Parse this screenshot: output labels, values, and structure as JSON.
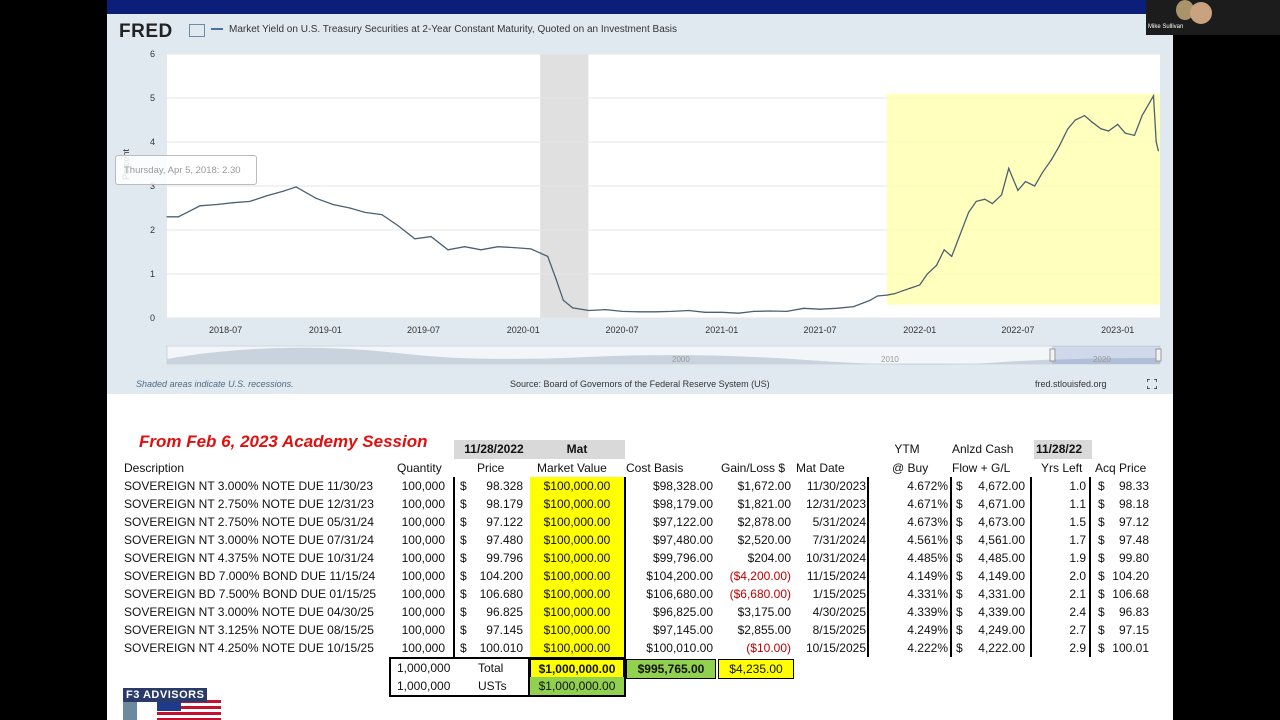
{
  "fred": {
    "logo": "FRED",
    "series_title": "Market Yield on U.S. Treasury Securities at 2-Year Constant Maturity, Quoted on an Investment Basis",
    "y_axis_label": "Percent",
    "tooltip": {
      "date": "Thursday, Apr 5, 2018:",
      "value": "2.30"
    },
    "note": "Shaded areas indicate U.S. recessions.",
    "source": "Source: Board of Governors of the Federal Reserve System (US)",
    "site": "fred.stlouisfed.org",
    "navigator_labels": [
      "2000",
      "2010",
      "2020"
    ],
    "colors": {
      "line": "#4c6072",
      "recession": "#e0e0e0",
      "highlight": "#ffffb3",
      "frame": "#e1e9f0"
    }
  },
  "chart_data": {
    "type": "line",
    "title": "Market Yield on U.S. Treasury Securities at 2-Year Constant Maturity, Quoted on an Investment Basis",
    "ylabel": "Percent",
    "ylim": [
      0,
      6
    ],
    "y_ticks": [
      "0",
      "1",
      "2",
      "3",
      "4",
      "5",
      "6"
    ],
    "x_ticks": [
      "2018-07",
      "2019-01",
      "2019-07",
      "2020-01",
      "2020-07",
      "2021-01",
      "2021-07",
      "2022-01",
      "2022-07",
      "2023-01"
    ],
    "xlim": [
      "2018-03-15",
      "2023-03-20"
    ],
    "recession": [
      "2020-02-01",
      "2020-04-30"
    ],
    "highlight": {
      "x": [
        "2021-11-01",
        "2023-03-20"
      ],
      "y": [
        0.3,
        5.1
      ]
    },
    "series": [
      {
        "x": [
          "2018-03-15",
          "2018-04-05",
          "2018-05-15",
          "2018-06-15",
          "2018-07-15",
          "2018-08-15",
          "2018-09-15",
          "2018-10-15",
          "2018-11-08",
          "2018-12-15",
          "2019-01-15",
          "2019-02-15",
          "2019-03-15",
          "2019-04-15",
          "2019-05-15",
          "2019-06-15",
          "2019-07-15",
          "2019-08-15",
          "2019-09-15",
          "2019-10-15",
          "2019-11-15",
          "2019-12-15",
          "2020-01-15",
          "2020-02-15",
          "2020-03-01",
          "2020-03-15",
          "2020-04-01",
          "2020-05-01",
          "2020-06-01",
          "2020-07-01",
          "2020-08-01",
          "2020-09-01",
          "2020-10-01",
          "2020-11-01",
          "2020-12-01",
          "2021-01-01",
          "2021-02-01",
          "2021-03-01",
          "2021-04-01",
          "2021-05-01",
          "2021-06-01",
          "2021-07-01",
          "2021-08-01",
          "2021-09-01",
          "2021-10-01",
          "2021-10-15",
          "2021-11-01",
          "2021-11-15",
          "2021-12-01",
          "2021-12-15",
          "2022-01-01",
          "2022-01-15",
          "2022-02-01",
          "2022-02-15",
          "2022-03-01",
          "2022-03-15",
          "2022-04-01",
          "2022-04-15",
          "2022-05-01",
          "2022-05-15",
          "2022-06-01",
          "2022-06-14",
          "2022-07-01",
          "2022-07-15",
          "2022-08-01",
          "2022-08-15",
          "2022-09-01",
          "2022-09-15",
          "2022-10-01",
          "2022-10-15",
          "2022-11-01",
          "2022-11-15",
          "2022-12-01",
          "2022-12-15",
          "2023-01-01",
          "2023-01-15",
          "2023-02-01",
          "2023-02-15",
          "2023-03-01",
          "2023-03-08",
          "2023-03-13",
          "2023-03-17"
        ],
        "y": [
          2.3,
          2.3,
          2.55,
          2.58,
          2.62,
          2.65,
          2.78,
          2.88,
          2.98,
          2.72,
          2.58,
          2.5,
          2.4,
          2.35,
          2.1,
          1.8,
          1.85,
          1.55,
          1.62,
          1.55,
          1.62,
          1.6,
          1.57,
          1.4,
          0.9,
          0.4,
          0.23,
          0.17,
          0.19,
          0.15,
          0.14,
          0.14,
          0.15,
          0.17,
          0.13,
          0.13,
          0.11,
          0.15,
          0.16,
          0.15,
          0.22,
          0.2,
          0.22,
          0.26,
          0.4,
          0.5,
          0.52,
          0.55,
          0.62,
          0.68,
          0.75,
          1.0,
          1.2,
          1.55,
          1.4,
          1.85,
          2.4,
          2.65,
          2.7,
          2.6,
          2.8,
          3.4,
          2.9,
          3.1,
          3.0,
          3.3,
          3.6,
          3.9,
          4.3,
          4.5,
          4.6,
          4.45,
          4.3,
          4.25,
          4.4,
          4.2,
          4.15,
          4.6,
          4.9,
          5.05,
          4.0,
          3.8
        ]
      }
    ]
  },
  "session_title": "From Feb 6, 2023 Academy Session",
  "table": {
    "top_headers": {
      "date1": "11/28/2022",
      "mat": "Mat",
      "ytm": "YTM",
      "anlzd": "Anlzd Cash",
      "date2": "11/28/22"
    },
    "columns": [
      "Description",
      "Quantity",
      "Price",
      "Market Value",
      "Cost Basis",
      "Gain/Loss $",
      "Mat Date",
      "@ Buy",
      "Flow + G/L",
      "Yrs Left",
      "Acq Price"
    ],
    "rows": [
      {
        "desc": "SOVEREIGN NT 3.000% NOTE DUE 11/30/23",
        "qty": "100,000",
        "price": "98.328",
        "mv": "$100,000.00",
        "cost": "$98,328.00",
        "gl": "$1,672.00",
        "gl_neg": false,
        "mat": "11/30/2023",
        "ytm": "4.672%",
        "cf": "4,672.00",
        "yrs": "1.0",
        "acq": "98.33"
      },
      {
        "desc": "SOVEREIGN NT 2.750% NOTE DUE 12/31/23",
        "qty": "100,000",
        "price": "98.179",
        "mv": "$100,000.00",
        "cost": "$98,179.00",
        "gl": "$1,821.00",
        "gl_neg": false,
        "mat": "12/31/2023",
        "ytm": "4.671%",
        "cf": "4,671.00",
        "yrs": "1.1",
        "acq": "98.18"
      },
      {
        "desc": "SOVEREIGN NT 2.750% NOTE DUE 05/31/24",
        "qty": "100,000",
        "price": "97.122",
        "mv": "$100,000.00",
        "cost": "$97,122.00",
        "gl": "$2,878.00",
        "gl_neg": false,
        "mat": "5/31/2024",
        "ytm": "4.673%",
        "cf": "4,673.00",
        "yrs": "1.5",
        "acq": "97.12"
      },
      {
        "desc": "SOVEREIGN NT 3.000% NOTE DUE 07/31/24",
        "qty": "100,000",
        "price": "97.480",
        "mv": "$100,000.00",
        "cost": "$97,480.00",
        "gl": "$2,520.00",
        "gl_neg": false,
        "mat": "7/31/2024",
        "ytm": "4.561%",
        "cf": "4,561.00",
        "yrs": "1.7",
        "acq": "97.48"
      },
      {
        "desc": "SOVEREIGN NT 4.375% NOTE DUE 10/31/24",
        "qty": "100,000",
        "price": "99.796",
        "mv": "$100,000.00",
        "cost": "$99,796.00",
        "gl": "$204.00",
        "gl_neg": false,
        "mat": "10/31/2024",
        "ytm": "4.485%",
        "cf": "4,485.00",
        "yrs": "1.9",
        "acq": "99.80"
      },
      {
        "desc": "SOVEREIGN BD 7.000% BOND DUE 11/15/24",
        "qty": "100,000",
        "price": "104.200",
        "mv": "$100,000.00",
        "cost": "$104,200.00",
        "gl": "($4,200.00)",
        "gl_neg": true,
        "mat": "11/15/2024",
        "ytm": "4.149%",
        "cf": "4,149.00",
        "yrs": "2.0",
        "acq": "104.20"
      },
      {
        "desc": "SOVEREIGN BD 7.500% BOND DUE 01/15/25",
        "qty": "100,000",
        "price": "106.680",
        "mv": "$100,000.00",
        "cost": "$106,680.00",
        "gl": "($6,680.00)",
        "gl_neg": true,
        "mat": "1/15/2025",
        "ytm": "4.331%",
        "cf": "4,331.00",
        "yrs": "2.1",
        "acq": "106.68"
      },
      {
        "desc": "SOVEREIGN NT 3.000% NOTE DUE 04/30/25",
        "qty": "100,000",
        "price": "96.825",
        "mv": "$100,000.00",
        "cost": "$96,825.00",
        "gl": "$3,175.00",
        "gl_neg": false,
        "mat": "4/30/2025",
        "ytm": "4.339%",
        "cf": "4,339.00",
        "yrs": "2.4",
        "acq": "96.83"
      },
      {
        "desc": "SOVEREIGN NT 3.125% NOTE DUE 08/15/25",
        "qty": "100,000",
        "price": "97.145",
        "mv": "$100,000.00",
        "cost": "$97,145.00",
        "gl": "$2,855.00",
        "gl_neg": false,
        "mat": "8/15/2025",
        "ytm": "4.249%",
        "cf": "4,249.00",
        "yrs": "2.7",
        "acq": "97.15"
      },
      {
        "desc": "SOVEREIGN NT 4.250% NOTE DUE 10/15/25",
        "qty": "100,000",
        "price": "100.010",
        "mv": "$100,000.00",
        "cost": "$100,010.00",
        "gl": "($10.00)",
        "gl_neg": true,
        "mat": "10/15/2025",
        "ytm": "4.222%",
        "cf": "4,222.00",
        "yrs": "2.9",
        "acq": "100.01"
      }
    ],
    "totals": {
      "qty": "1,000,000",
      "label": "Total",
      "mv": "$1,000,000.00",
      "cost": "$995,765.00",
      "gl": "$4,235.00"
    },
    "usts": {
      "qty": "1,000,000",
      "label": "USTs",
      "mv": "$1,000,000.00"
    },
    "currency": "$"
  },
  "webcam": {
    "name": "Mike Sullivan"
  },
  "branding": {
    "logo_text": "F3 ADVISORS"
  }
}
